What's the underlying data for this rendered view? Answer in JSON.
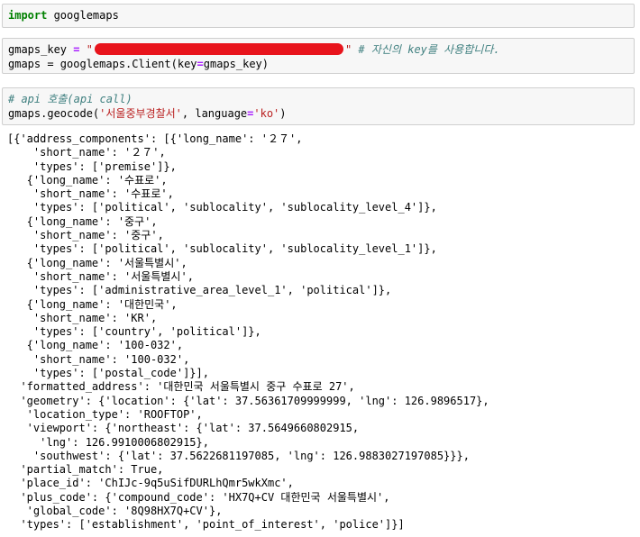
{
  "cells": [
    {
      "code_keyword": "import",
      "code_rest": " googlemaps"
    },
    {
      "line1_var": "gmaps_key",
      "line1_eq": " = ",
      "line1_open_quote": "\"",
      "line1_close_quote": "\"",
      "line1_comment": "# 자신의 key를 사용합니다.",
      "line2_prefix": "gmaps = googlemaps.Client(key",
      "line2_eq": "=",
      "line2_suffix": "gmaps_key)"
    },
    {
      "comment": "# api 호출(api call)",
      "call_prefix": "gmaps.geocode(",
      "arg_str": "'서울중부경찰서'",
      "sep": ", language",
      "eq": "=",
      "lang_str": "'ko'",
      "close": ")"
    }
  ],
  "output_lines": [
    "[{'address_components': [{'long_name': '２７',",
    "    'short_name': '２７',",
    "    'types': ['premise']},",
    "   {'long_name': '수표로',",
    "    'short_name': '수표로',",
    "    'types': ['political', 'sublocality', 'sublocality_level_4']},",
    "   {'long_name': '중구',",
    "    'short_name': '중구',",
    "    'types': ['political', 'sublocality', 'sublocality_level_1']},",
    "   {'long_name': '서울특별시',",
    "    'short_name': '서울특별시',",
    "    'types': ['administrative_area_level_1', 'political']},",
    "   {'long_name': '대한민국',",
    "    'short_name': 'KR',",
    "    'types': ['country', 'political']},",
    "   {'long_name': '100-032',",
    "    'short_name': '100-032',",
    "    'types': ['postal_code']}],",
    "  'formatted_address': '대한민국 서울특별시 중구 수표로 27',",
    "  'geometry': {'location': {'lat': 37.56361709999999, 'lng': 126.9896517},",
    "   'location_type': 'ROOFTOP',",
    "   'viewport': {'northeast': {'lat': 37.5649660802915,",
    "     'lng': 126.9910006802915},",
    "    'southwest': {'lat': 37.5622681197085, 'lng': 126.9883027197085}}},",
    "  'partial_match': True,",
    "  'place_id': 'ChIJc-9q5uSifDURLhQmr5wkXmc',",
    "  'plus_code': {'compound_code': 'HX7Q+CV 대한민국 서울특별시',",
    "   'global_code': '8Q98HX7Q+CV'},",
    "  'types': ['establishment', 'point_of_interest', 'police']}]"
  ],
  "colors": {
    "cell_background": "#f7f7f7",
    "cell_border": "#cfcfcf",
    "keyword": "#008000",
    "string": "#ba2121",
    "operator": "#aa22ff",
    "comment": "#408080",
    "redaction": "#e8141c"
  }
}
